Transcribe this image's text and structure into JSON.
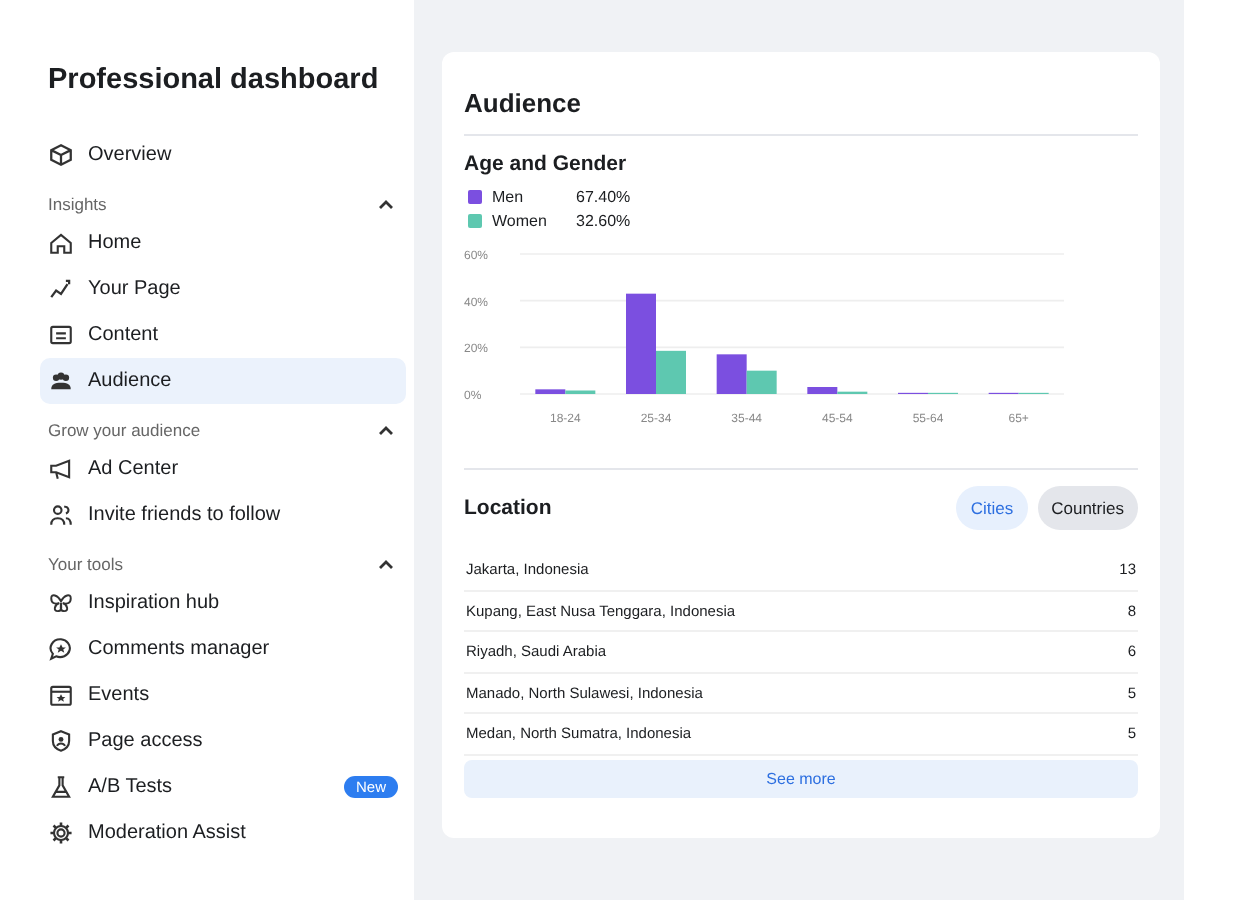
{
  "sidebar": {
    "title": "Professional dashboard",
    "items": [
      {
        "label": "Overview",
        "selected": false
      }
    ],
    "sections": [
      {
        "header": "Insights",
        "expanded": true,
        "items": [
          {
            "label": "Home",
            "selected": false
          },
          {
            "label": "Your Page",
            "selected": false
          },
          {
            "label": "Content",
            "selected": false
          },
          {
            "label": "Audience",
            "selected": true
          }
        ]
      },
      {
        "header": "Grow your audience",
        "expanded": true,
        "items": [
          {
            "label": "Ad Center",
            "selected": false
          },
          {
            "label": "Invite friends to follow",
            "selected": false
          }
        ]
      },
      {
        "header": "Your tools",
        "expanded": true,
        "items": [
          {
            "label": "Inspiration hub",
            "selected": false
          },
          {
            "label": "Comments manager",
            "selected": false
          },
          {
            "label": "Events",
            "selected": false
          },
          {
            "label": "Page access",
            "selected": false
          },
          {
            "label": "A/B Tests",
            "selected": false,
            "badge": "New"
          },
          {
            "label": "Moderation Assist",
            "selected": false
          }
        ]
      }
    ]
  },
  "main": {
    "title": "Audience",
    "age_gender": {
      "title": "Age and Gender",
      "legend_values": [
        "67.40%",
        "32.60%"
      ],
      "chart_data": {
        "type": "bar",
        "categories": [
          "18-24",
          "25-34",
          "35-44",
          "45-54",
          "55-64",
          "65+"
        ],
        "series": [
          {
            "name": "Men",
            "color": "#7b4fe0",
            "values": [
              2,
              43,
              17,
              3,
              0.5,
              0.5
            ]
          },
          {
            "name": "Women",
            "color": "#5ec8b0",
            "values": [
              1.5,
              18.5,
              10,
              1,
              0.5,
              0.5
            ]
          }
        ],
        "ylim": [
          0,
          60
        ],
        "yticks": [
          {
            "value": 0,
            "label": "0%"
          },
          {
            "value": 20,
            "label": "20%"
          },
          {
            "value": 40,
            "label": "40%"
          },
          {
            "value": 60,
            "label": "60%"
          }
        ]
      }
    },
    "location": {
      "title": "Location",
      "tabs": [
        {
          "label": "Cities",
          "selected": true
        },
        {
          "label": "Countries",
          "selected": false
        }
      ],
      "rows": [
        {
          "place": "Jakarta, Indonesia",
          "count": "13"
        },
        {
          "place": "Kupang, East Nusa Tenggara, Indonesia",
          "count": "8"
        },
        {
          "place": "Riyadh, Saudi Arabia",
          "count": "6"
        },
        {
          "place": "Manado, North Sulawesi, Indonesia",
          "count": "5"
        },
        {
          "place": "Medan, North Sumatra, Indonesia",
          "count": "5"
        }
      ],
      "see_more": "See more"
    }
  }
}
